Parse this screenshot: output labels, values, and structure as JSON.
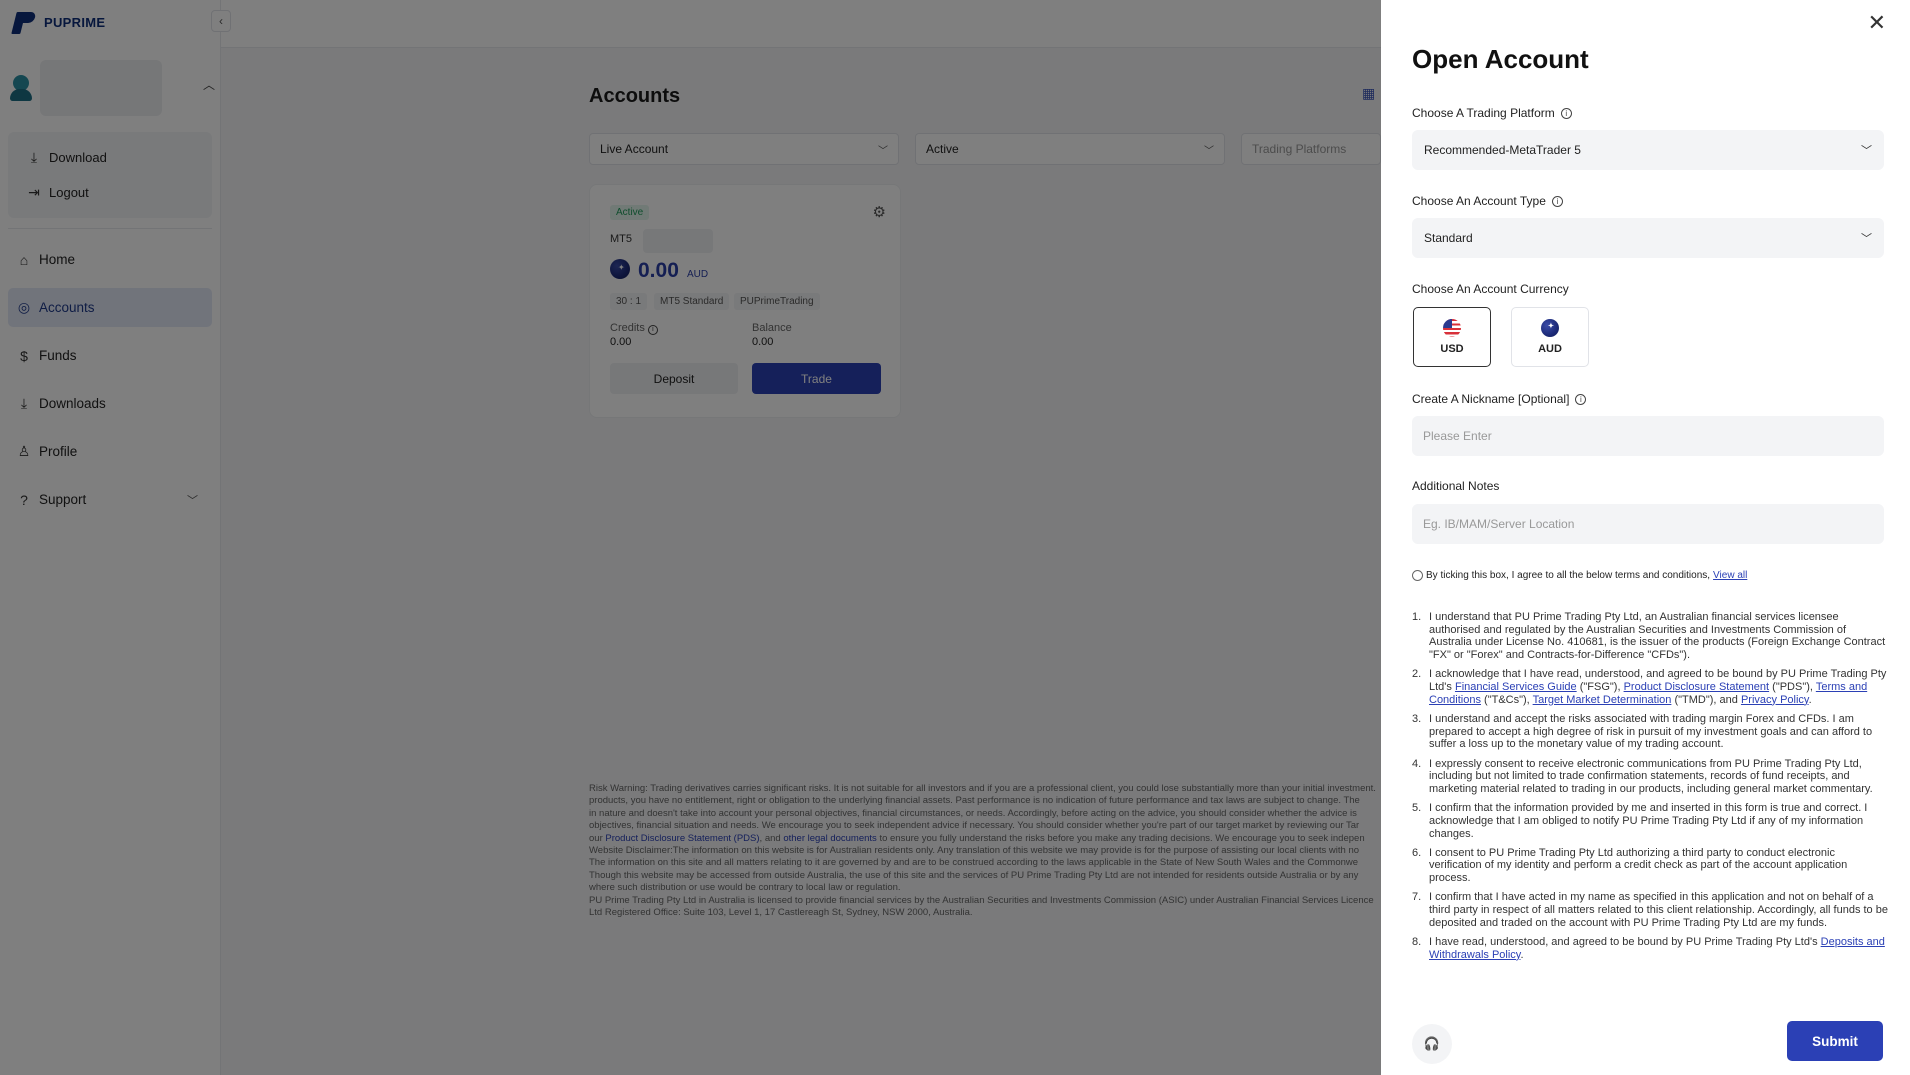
{
  "brand": {
    "name": "PUPRIME"
  },
  "sidebar": {
    "collapse_icon": "chevron-left-icon",
    "user_menu": [
      {
        "label": "Download",
        "icon": "download-icon"
      },
      {
        "label": "Logout",
        "icon": "logout-icon"
      }
    ],
    "nav": [
      {
        "label": "Home",
        "icon": "home-icon",
        "active": false
      },
      {
        "label": "Accounts",
        "icon": "accounts-icon",
        "active": true
      },
      {
        "label": "Funds",
        "icon": "funds-icon",
        "active": false
      },
      {
        "label": "Downloads",
        "icon": "downloads-icon",
        "active": false
      },
      {
        "label": "Profile",
        "icon": "profile-icon",
        "active": false
      },
      {
        "label": "Support",
        "icon": "support-icon",
        "active": false
      }
    ]
  },
  "main": {
    "title": "Accounts",
    "filters": {
      "account_type": "Live Account",
      "status": "Active",
      "platforms_placeholder": "Trading Platforms"
    },
    "account_card": {
      "status": "Active",
      "platform": "MT5",
      "balance": "0.00",
      "currency": "AUD",
      "leverage": "30 : 1",
      "account_type": "MT5 Standard",
      "server": "PUPrimeTrading",
      "credits_label": "Credits",
      "credits_value": "0.00",
      "balance_label": "Balance",
      "balance_value": "0.00",
      "deposit_label": "Deposit",
      "trade_label": "Trade"
    },
    "disclaimer": {
      "line1": "Risk Warning: Trading derivatives carries significant risks. It is not suitable for all investors and if you are a professional client, you could lose substantially more than your initial investment.",
      "line2": "products, you have no entitlement, right or obligation to the underlying financial assets. Past performance is no indication of future performance and tax laws are subject to change. The",
      "line3": "in nature and doesn't take into account your personal objectives, financial circumstances, or needs. Accordingly, before acting on the advice, you should consider whether the advice is",
      "line4": "objectives, financial situation and needs. We encourage you to seek independent advice if necessary. You should consider whether you're part of our target market by reviewing our Tar",
      "line5_pre": "our",
      "pds_link": "Product Disclosure Statement (PDS)",
      "line5_mid": ", and",
      "legal_link": "other legal documents",
      "line5_post": "to ensure you fully understand the risks before you make any trading decisions. We encourage you to seek indepen",
      "line6": "Website Disclaimer:The information on this website is for Australian residents only. Any translation of this website we may provide is for the purpose of assisting our local clients with no",
      "line7": "The information on this site and all matters relating to it are governed by and are to be construed according to the laws applicable in the State of New South Wales and the Commonwe",
      "line8": "Though this website may be accessed from outside Australia, the use of this site and the services of PU Prime Trading Pty Ltd are not intended for residents outside Australia or by any",
      "line9": "where such distribution or use would be contrary to local law or regulation.",
      "line10": "PU Prime Trading Pty Ltd in Australia is licensed to provide financial services by the Australian Securities and Investments Commission (ASIC) under Australian Financial Services Licence",
      "line11": "Ltd Registered Office: Suite 103, Level 1, 17 Castlereagh St, Sydney, NSW 2000, Australia."
    }
  },
  "drawer": {
    "title": "Open Account",
    "platform_label": "Choose A Trading Platform",
    "platform_value": "Recommended-MetaTrader 5",
    "account_type_label": "Choose An Account Type",
    "account_type_value": "Standard",
    "currency_label": "Choose An Account Currency",
    "currencies": [
      {
        "code": "USD",
        "selected": true
      },
      {
        "code": "AUD",
        "selected": false
      }
    ],
    "nickname_label": "Create A Nickname [Optional]",
    "nickname_placeholder": "Please Enter",
    "notes_label": "Additional Notes",
    "notes_placeholder": "Eg. IB/MAM/Server Location",
    "agree_text": "By ticking this box, I agree to all the below terms and conditions,",
    "view_all": "View all",
    "terms": {
      "t1": "I understand that PU Prime Trading Pty Ltd, an Australian financial services licensee authorised and regulated by the Australian Securities and Investments Commission of Australia under License No. 410681, is the issuer of the products (Foreign Exchange Contract \"FX\" or \"Forex\" and Contracts-for-Difference \"CFDs\").",
      "t2_pre": "I acknowledge that I have read, understood, and agreed to be bound by PU Prime Trading Pty Ltd's",
      "t2_fsg": "Financial Services Guide",
      "t2_a": "(\"FSG\"),",
      "t2_pds": "Product Disclosure Statement",
      "t2_b": "(\"PDS\"),",
      "t2_tc": "Terms and Conditions",
      "t2_c": "(\"T&Cs\"),",
      "t2_tmd": "Target Market Determination",
      "t2_d": "(\"TMD\"), and",
      "t2_privacy": "Privacy Policy",
      "t3": "I understand and accept the risks associated with trading margin Forex and CFDs. I am prepared to accept a high degree of risk in pursuit of my investment goals and can afford to suffer a loss up to the monetary value of my trading account.",
      "t4": "I expressly consent to receive electronic communications from PU Prime Trading Pty Ltd, including but not limited to trade confirmation statements, records of fund receipts, and marketing material related to trading in our products, including general market commentary.",
      "t5": "I confirm that the information provided by me and inserted in this form is true and correct. I acknowledge that I am obliged to notify PU Prime Trading Pty Ltd if any of my information changes.",
      "t6": "I consent to PU Prime Trading Pty Ltd authorizing a third party to conduct electronic verification of my identity and perform a credit check as part of the account application process.",
      "t7": "I confirm that I have acted in my name as specified in this application and not on behalf of a third party in respect of all matters related to this client relationship. Accordingly, all funds to be deposited and traded on the account with PU Prime Trading Pty Ltd are my funds.",
      "t8_pre": "I have read, understood, and agreed to be bound by PU Prime Trading Pty Ltd's",
      "t8_link": "Deposits and Withdrawals Policy"
    },
    "submit_label": "Submit",
    "colors": {
      "accent": "#2b40b5",
      "brand": "#0f2f7a"
    }
  }
}
